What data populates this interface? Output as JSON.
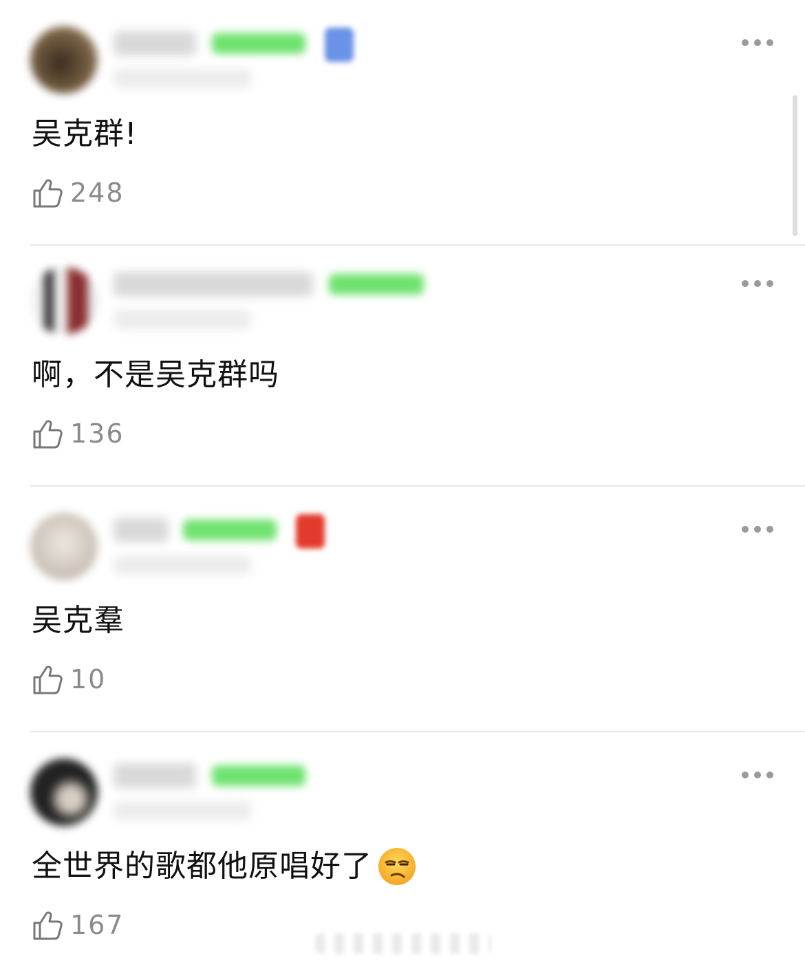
{
  "comments": [
    {
      "text": "吴克群!",
      "likes": "248",
      "avatar_color": "#5a4630",
      "extra_badge_color": "#6a92e6"
    },
    {
      "text": "啊，不是吴克群吗",
      "likes": "136",
      "avatar_color": "#7a4a4a",
      "extra_badge_color": ""
    },
    {
      "text": "吴克羣",
      "likes": "10",
      "avatar_color": "#cfc8c0",
      "extra_badge_color": "#e23a2c"
    },
    {
      "text": "全世界的歌都他原唱好了",
      "likes": "167",
      "avatar_color": "#2b2b2b",
      "extra_badge_color": "",
      "emoji": "unamused-face"
    }
  ],
  "icons": {
    "like": "thumbs-up-icon",
    "more": "more-dots-icon"
  },
  "colors": {
    "level_badge": "#6ee26e",
    "like_count": "#8a8a8a",
    "divider": "#e8e8e8"
  }
}
